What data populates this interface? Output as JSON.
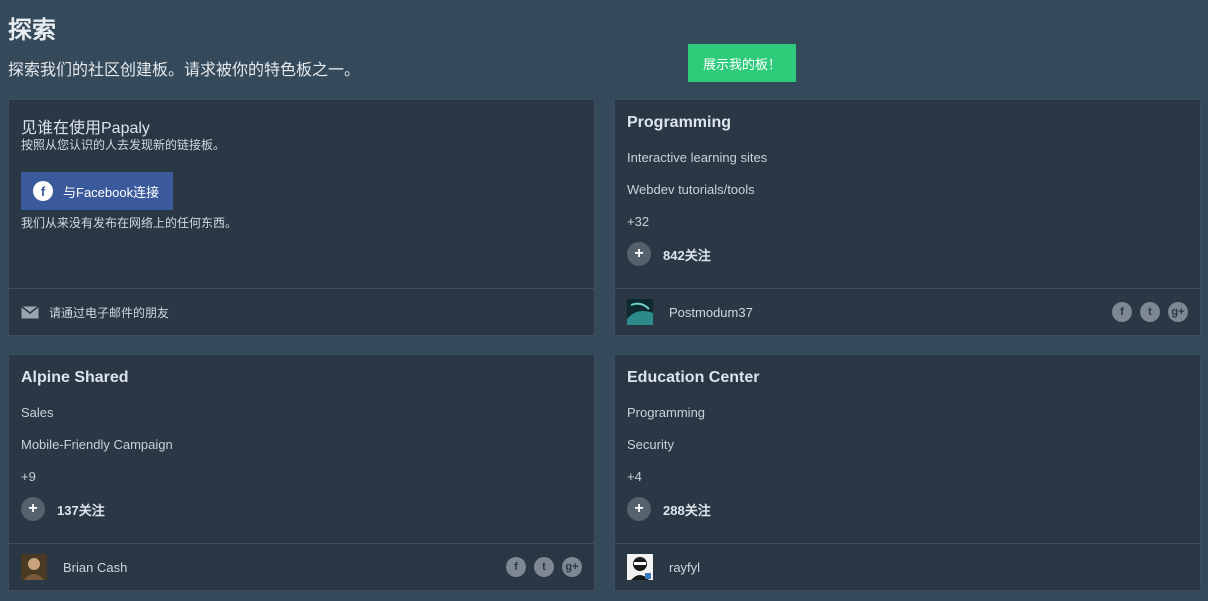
{
  "header": {
    "title": "探索",
    "subtitle": "探索我们的社区创建板。请求被你的特色板之一。",
    "showcase_button": "展示我的板！"
  },
  "who_card": {
    "title": "见谁在使用Papaly",
    "subtitle": "按照从您认识的人去发现新的链接板。",
    "fb_button": "与Facebook连接",
    "fb_glyph": "f",
    "note": "我们从来没有发布在网络上的任何东西。",
    "mail_link": "请通过电子邮件的朋友"
  },
  "boards": [
    {
      "title": "Programming",
      "items": [
        "Interactive learning sites",
        "Webdev tutorials/tools",
        "+32"
      ],
      "follow_count": "842关注",
      "owner": "Postmodum37",
      "avatar_icon": "abstract-teal-avatar"
    },
    {
      "title": "Alpine Shared",
      "items": [
        "Sales",
        "Mobile-Friendly Campaign",
        "+9"
      ],
      "follow_count": "137关注",
      "owner": "Brian Cash",
      "avatar_icon": "photo-avatar"
    },
    {
      "title": "Education Center",
      "items": [
        "Programming",
        "Security",
        "+4"
      ],
      "follow_count": "288关注",
      "owner": "rayfyl",
      "avatar_icon": "masked-avatar"
    }
  ],
  "share_glyphs": {
    "facebook": "f",
    "twitter": "t",
    "google": "g+"
  },
  "colors": {
    "background": "#34495a",
    "card": "#2a3846",
    "accent_green": "#2ecc7a",
    "facebook_blue": "#3a5a9b"
  }
}
